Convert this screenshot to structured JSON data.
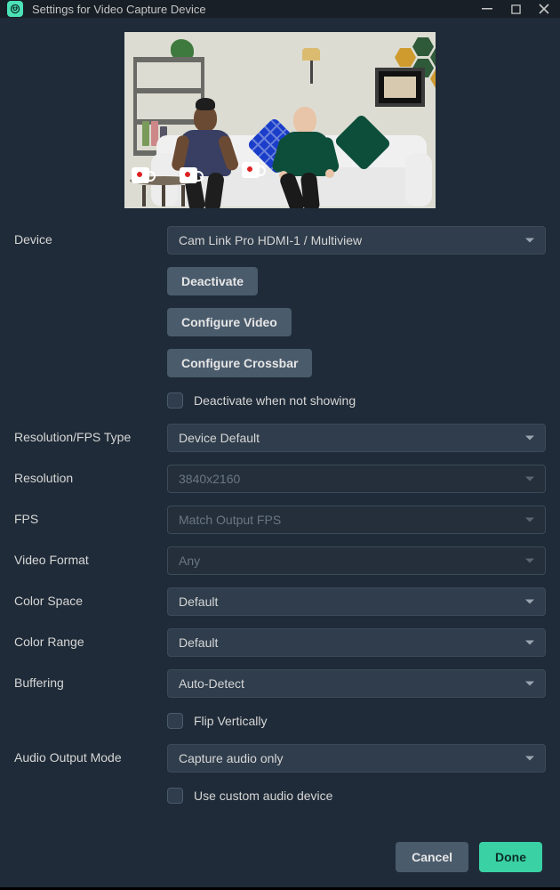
{
  "titlebar": {
    "title": "Settings for Video Capture Device"
  },
  "labels": {
    "device": "Device",
    "resolution_fps_type": "Resolution/FPS Type",
    "resolution": "Resolution",
    "fps": "FPS",
    "video_format": "Video Format",
    "color_space": "Color Space",
    "color_range": "Color Range",
    "buffering": "Buffering",
    "audio_output_mode": "Audio Output Mode"
  },
  "values": {
    "device": "Cam Link Pro HDMI-1 / Multiview",
    "resolution_fps_type": "Device Default",
    "resolution": "3840x2160",
    "fps": "Match Output FPS",
    "video_format": "Any",
    "color_space": "Default",
    "color_range": "Default",
    "buffering": "Auto-Detect",
    "audio_output_mode": "Capture audio only"
  },
  "buttons": {
    "deactivate": "Deactivate",
    "configure_video": "Configure Video",
    "configure_crossbar": "Configure Crossbar",
    "cancel": "Cancel",
    "done": "Done"
  },
  "checkboxes": {
    "deactivate_when_not_showing": "Deactivate when not showing",
    "flip_vertically": "Flip Vertically",
    "use_custom_audio_device": "Use custom audio device"
  }
}
